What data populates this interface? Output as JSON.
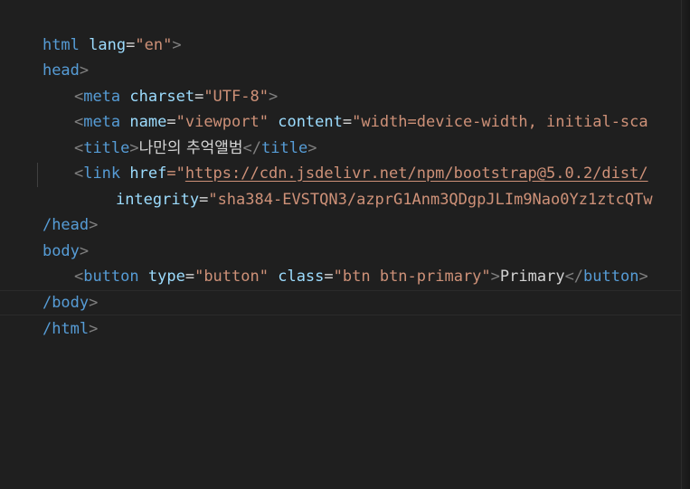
{
  "lines": [
    {
      "tag": "html",
      "attr": "lang",
      "value": "\"en\"",
      "close": ">"
    },
    {
      "tag": "head",
      "close": ">"
    },
    {
      "tag": "meta",
      "attr": "charset",
      "value": "\"UTF-8\"",
      "close": ">"
    },
    {
      "tag": "meta",
      "attr1": "name",
      "value1": "\"viewport\"",
      "attr2": "content",
      "value2": "\"width=device-width, initial-sca"
    },
    {
      "open": "<",
      "tag": "title",
      "text": "나만의 추억앨범",
      "close_tag": "</",
      "tag2": "title",
      "close": ">"
    },
    {
      "open": "<",
      "tag": "link",
      "attr": "href",
      "value_prefix": "=\"",
      "url": "https://cdn.jsdelivr.net/npm/bootstrap@5.0.2/dist/"
    },
    {
      "attr": "integrity",
      "value": "\"sha384-EVSTQN3/azprG1Anm3QDgpJLIm9Nao0Yz1ztcQTw"
    },
    {
      "tag": "/head",
      "close": ">"
    },
    {
      "tag": "body",
      "close": ">"
    },
    {
      "open": "<",
      "tag": "button",
      "attr1": "type",
      "value1": "\"button\"",
      "attr2": "class",
      "value2": "\"btn btn-primary\"",
      "text": "Primary",
      "close_tag": "</",
      "tag2": "button",
      "close": ">"
    },
    {
      "tag": "/body",
      "close": ">"
    },
    {
      "tag": "/html",
      "close": ">"
    }
  ]
}
